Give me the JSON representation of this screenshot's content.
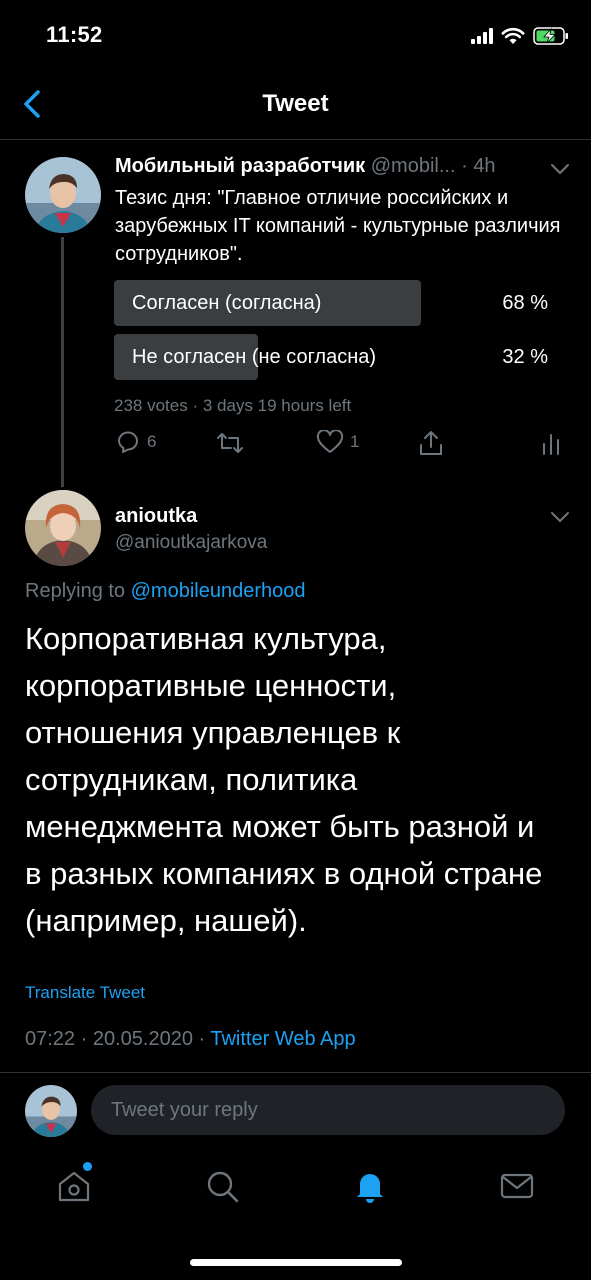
{
  "status_bar": {
    "time": "11:52"
  },
  "nav": {
    "title": "Tweet"
  },
  "tweet": {
    "author_name": "Мобильный разработчик",
    "author_handle": "@mobil...",
    "age": "4h",
    "text": "Тезис дня: \"Главное отличие российских и зарубежных IT компаний - культурные различия сотрудников\".",
    "poll": {
      "options": [
        {
          "label": "Согласен (согласна)",
          "percent_text": "68 %",
          "percent": 68
        },
        {
          "label": "Не согласен (не согласна)",
          "percent_text": "32 %",
          "percent": 32
        }
      ],
      "votes": "238 votes",
      "time_left": "3 days 19 hours left"
    },
    "actions": {
      "replies": "6",
      "likes": "1"
    }
  },
  "reply": {
    "author_name": "anioutka",
    "author_handle": "@anioutkajarkova",
    "replying_prefix": "Replying to ",
    "replying_to": "@mobileunderhood",
    "text_lines": [
      "Корпоративная культура,",
      "корпоративные ценности,",
      "отношения управленцев к",
      "сотрудникам, политика",
      "менеджмента может быть разной и",
      "в разных компаниях в одной стране",
      "(например, нашей)."
    ],
    "translate_label": "Translate Tweet",
    "time": "07:22",
    "date": "20.05.2020",
    "source": "Twitter Web App"
  },
  "reply_bar": {
    "placeholder": "Tweet your reply"
  },
  "tab_bar": {
    "items": [
      "home-icon",
      "search-icon",
      "notifications-icon",
      "messages-icon"
    ],
    "active": "notifications-icon"
  },
  "colors": {
    "accent": "#1da1f2",
    "secondary_text": "#6e767d",
    "poll_fill": "#3a3e41",
    "background": "#000000"
  }
}
